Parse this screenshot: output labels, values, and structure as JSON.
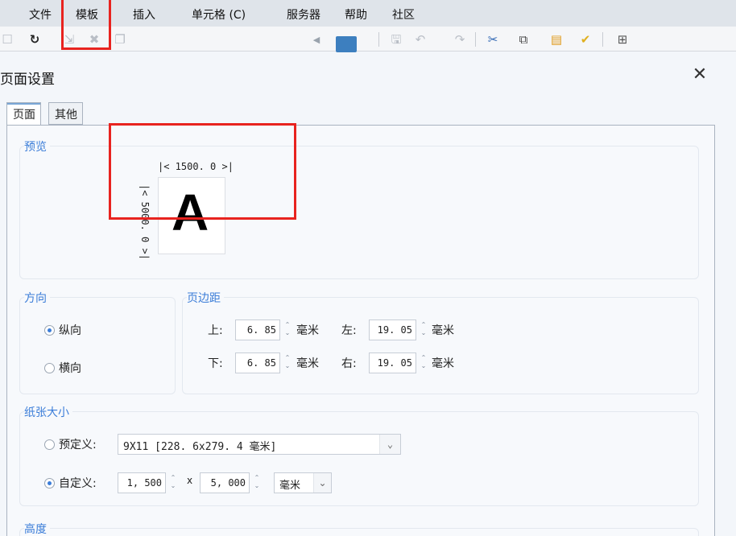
{
  "menu": {
    "file": "文件",
    "template": "模板",
    "insert": "插入",
    "cell": "单元格 (C)",
    "server": "服务器",
    "help": "帮助",
    "community": "社区"
  },
  "toolbar": {
    "icons": [
      "new-icon",
      "refresh-icon",
      "import-icon",
      "delete-icon",
      "copy-page-icon",
      "collapse-arrow-icon",
      "print-icon",
      "save-icon",
      "undo-icon",
      "redo-icon",
      "cut-icon",
      "copy-icon",
      "paste-icon",
      "format-brush-icon",
      "find-icon"
    ]
  },
  "dialog": {
    "title": "页面设置",
    "close": "✕",
    "tabs": [
      "页面",
      "其他"
    ]
  },
  "preview": {
    "title": "预览",
    "width": "|< 1500. 0 >|",
    "height": "|< 5000. 0 >|",
    "letter": "A"
  },
  "orientation": {
    "title": "方向",
    "portrait": "纵向",
    "landscape": "横向",
    "selected": "portrait"
  },
  "margins": {
    "title": "页边距",
    "top_label": "上:",
    "top_value": "6. 85",
    "left_label": "左:",
    "left_value": "19. 05",
    "bottom_label": "下:",
    "bottom_value": "6. 85",
    "right_label": "右:",
    "right_value": "19. 05",
    "unit": "毫米"
  },
  "paper": {
    "title": "纸张大小",
    "preset_label": "预定义:",
    "preset_value": "9X11 [228. 6x279. 4 毫米]",
    "custom_label": "自定义:",
    "custom_width": "1, 500",
    "times": "x",
    "custom_height": "5, 000",
    "unit": "毫米",
    "selected": "custom"
  },
  "height_section": {
    "title": "高度"
  },
  "colors": {
    "accent": "#3b7dd8",
    "highlight": "#e8231f"
  }
}
